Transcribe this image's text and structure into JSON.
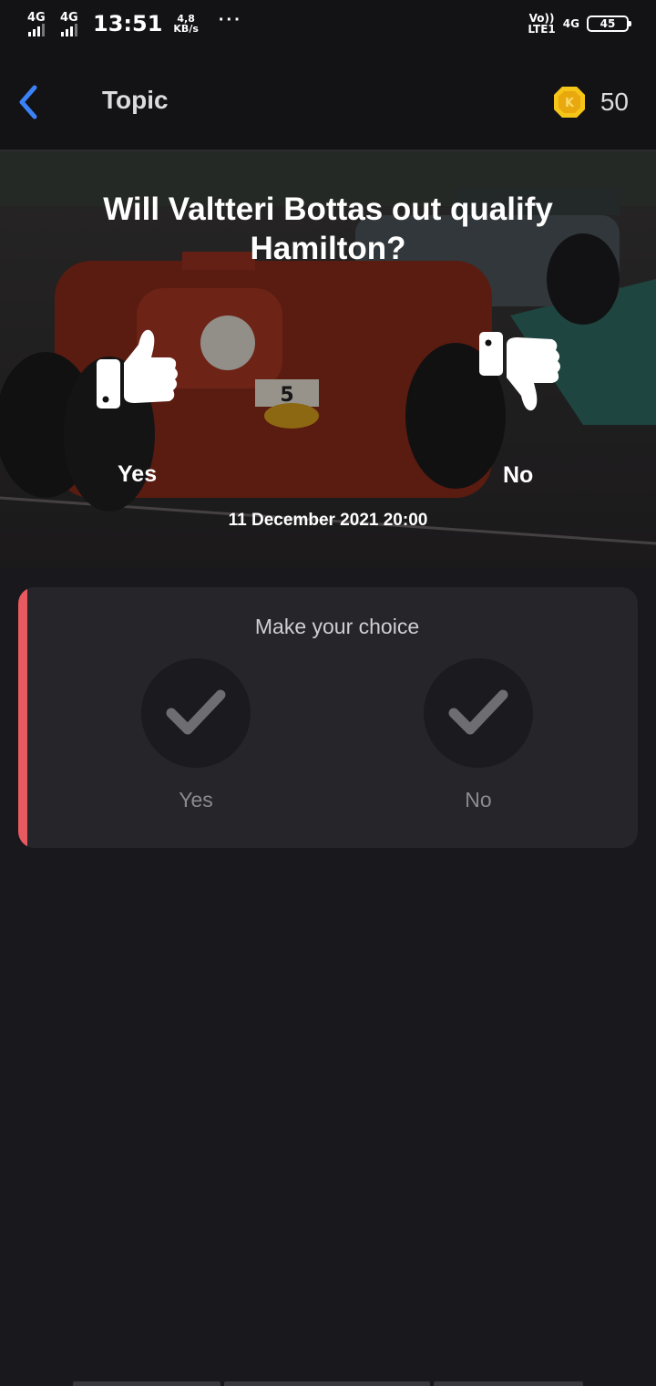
{
  "status_bar": {
    "network1": "4G",
    "network2": "4G",
    "time": "13:51",
    "speed_value": "4,8",
    "speed_unit": "KB/s",
    "more": "···",
    "volte_top": "Vo))",
    "volte_bottom": "LTE1",
    "network3": "4G",
    "battery": "45"
  },
  "app_bar": {
    "back_icon": "back-arrow-icon",
    "title": "Topic",
    "coin_icon": "coin-icon",
    "coins": "50"
  },
  "hero": {
    "question": "Will Valtteri Bottas out qualify Hamilton?",
    "yes_icon": "thumbs-up-icon",
    "no_icon": "thumbs-down-icon",
    "yes_label": "Yes",
    "no_label": "No",
    "date": "11 December 2021 20:00"
  },
  "choice_card": {
    "title": "Make your choice",
    "options": [
      {
        "label": "Yes",
        "icon": "check-icon"
      },
      {
        "label": "No",
        "icon": "check-icon"
      }
    ],
    "accent_color": "#e85a5f"
  },
  "colors": {
    "background": "#19181c",
    "card": "#262529",
    "back_icon": "#3b82f6",
    "coin": "#f5c518"
  }
}
